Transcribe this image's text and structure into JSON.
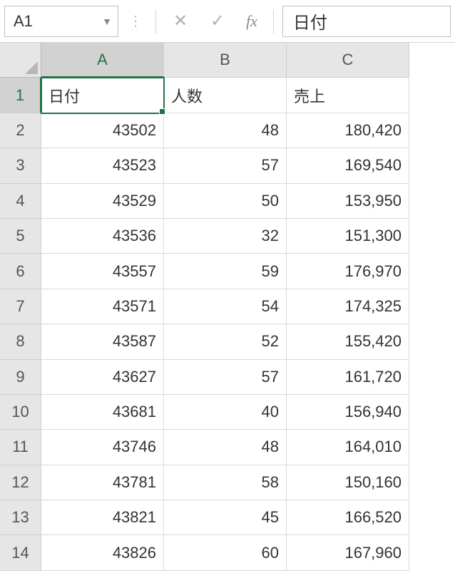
{
  "formula_bar": {
    "name_box": "A1",
    "formula_value": "日付"
  },
  "columns": [
    "A",
    "B",
    "C"
  ],
  "row_numbers": [
    "1",
    "2",
    "3",
    "4",
    "5",
    "6",
    "7",
    "8",
    "9",
    "10",
    "11",
    "12",
    "13",
    "14"
  ],
  "headers": {
    "A": "日付",
    "B": "人数",
    "C": "売上"
  },
  "rows": [
    {
      "A": "43502",
      "B": "48",
      "C": "180,420"
    },
    {
      "A": "43523",
      "B": "57",
      "C": "169,540"
    },
    {
      "A": "43529",
      "B": "50",
      "C": "153,950"
    },
    {
      "A": "43536",
      "B": "32",
      "C": "151,300"
    },
    {
      "A": "43557",
      "B": "59",
      "C": "176,970"
    },
    {
      "A": "43571",
      "B": "54",
      "C": "174,325"
    },
    {
      "A": "43587",
      "B": "52",
      "C": "155,420"
    },
    {
      "A": "43627",
      "B": "57",
      "C": "161,720"
    },
    {
      "A": "43681",
      "B": "40",
      "C": "156,940"
    },
    {
      "A": "43746",
      "B": "48",
      "C": "164,010"
    },
    {
      "A": "43781",
      "B": "58",
      "C": "150,160"
    },
    {
      "A": "43821",
      "B": "45",
      "C": "166,520"
    },
    {
      "A": "43826",
      "B": "60",
      "C": "167,960"
    }
  ],
  "active_cell": "A1"
}
